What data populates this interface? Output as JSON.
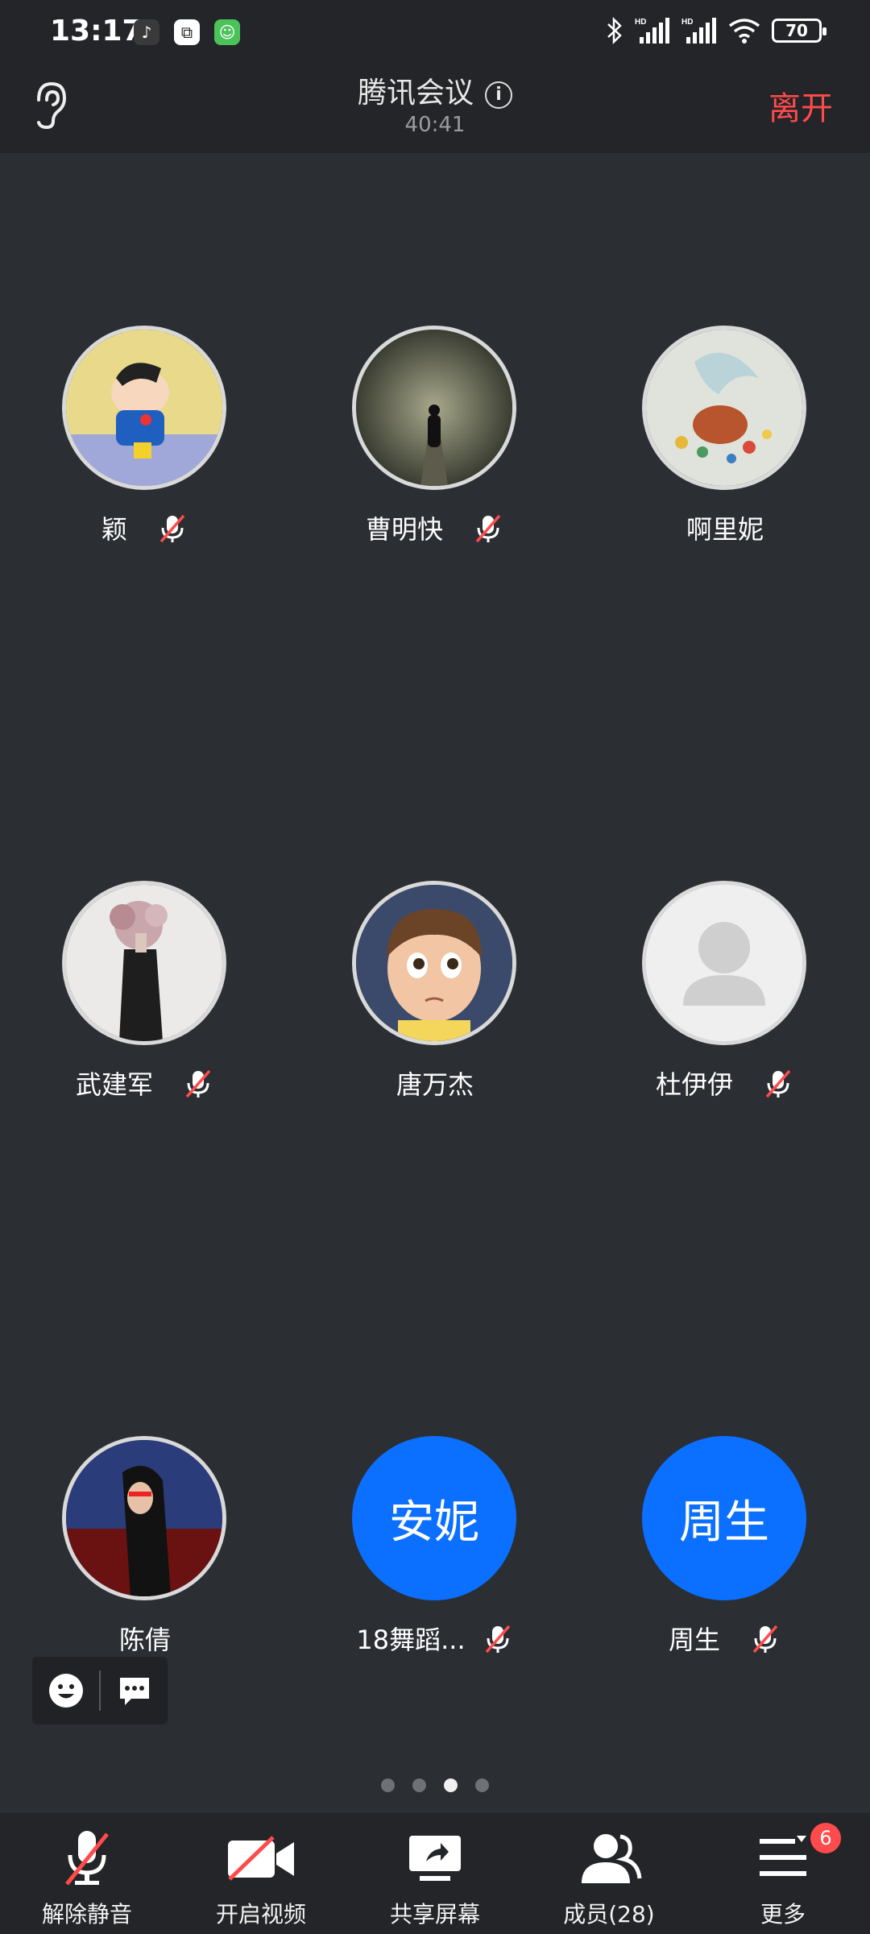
{
  "status_bar": {
    "time": "13:17",
    "battery": "70",
    "apps": [
      "tiktok-icon",
      "pip-icon",
      "assistant-icon"
    ]
  },
  "header": {
    "title": "腾讯会议",
    "timer": "40:41",
    "leave_label": "离开"
  },
  "participants": [
    {
      "name": "颖",
      "avatar": "photo",
      "muted": true
    },
    {
      "name": "曹明快",
      "avatar": "photo",
      "muted": true
    },
    {
      "name": "啊里妮",
      "avatar": "photo",
      "muted": false
    },
    {
      "name": "武建军",
      "avatar": "photo",
      "muted": true
    },
    {
      "name": "唐万杰",
      "avatar": "photo",
      "muted": false
    },
    {
      "name": "杜伊伊",
      "avatar": "placeholder",
      "muted": true
    },
    {
      "name": "陈倩",
      "avatar": "photo",
      "muted": false
    },
    {
      "name": "18舞蹈...",
      "avatar_text": "安妮",
      "muted": true
    },
    {
      "name": "周生",
      "avatar_text": "周生",
      "muted": true
    }
  ],
  "pagination": {
    "total": 4,
    "current": 3
  },
  "toolbar": {
    "unmute_label": "解除静音",
    "video_label": "开启视频",
    "share_label": "共享屏幕",
    "members_label": "成员(28)",
    "more_label": "更多",
    "more_badge": "6"
  },
  "colors": {
    "background": "#2b2e33",
    "bar": "#232528",
    "accent_blue": "#0b6fff",
    "leave_red": "#ff4b4b"
  }
}
